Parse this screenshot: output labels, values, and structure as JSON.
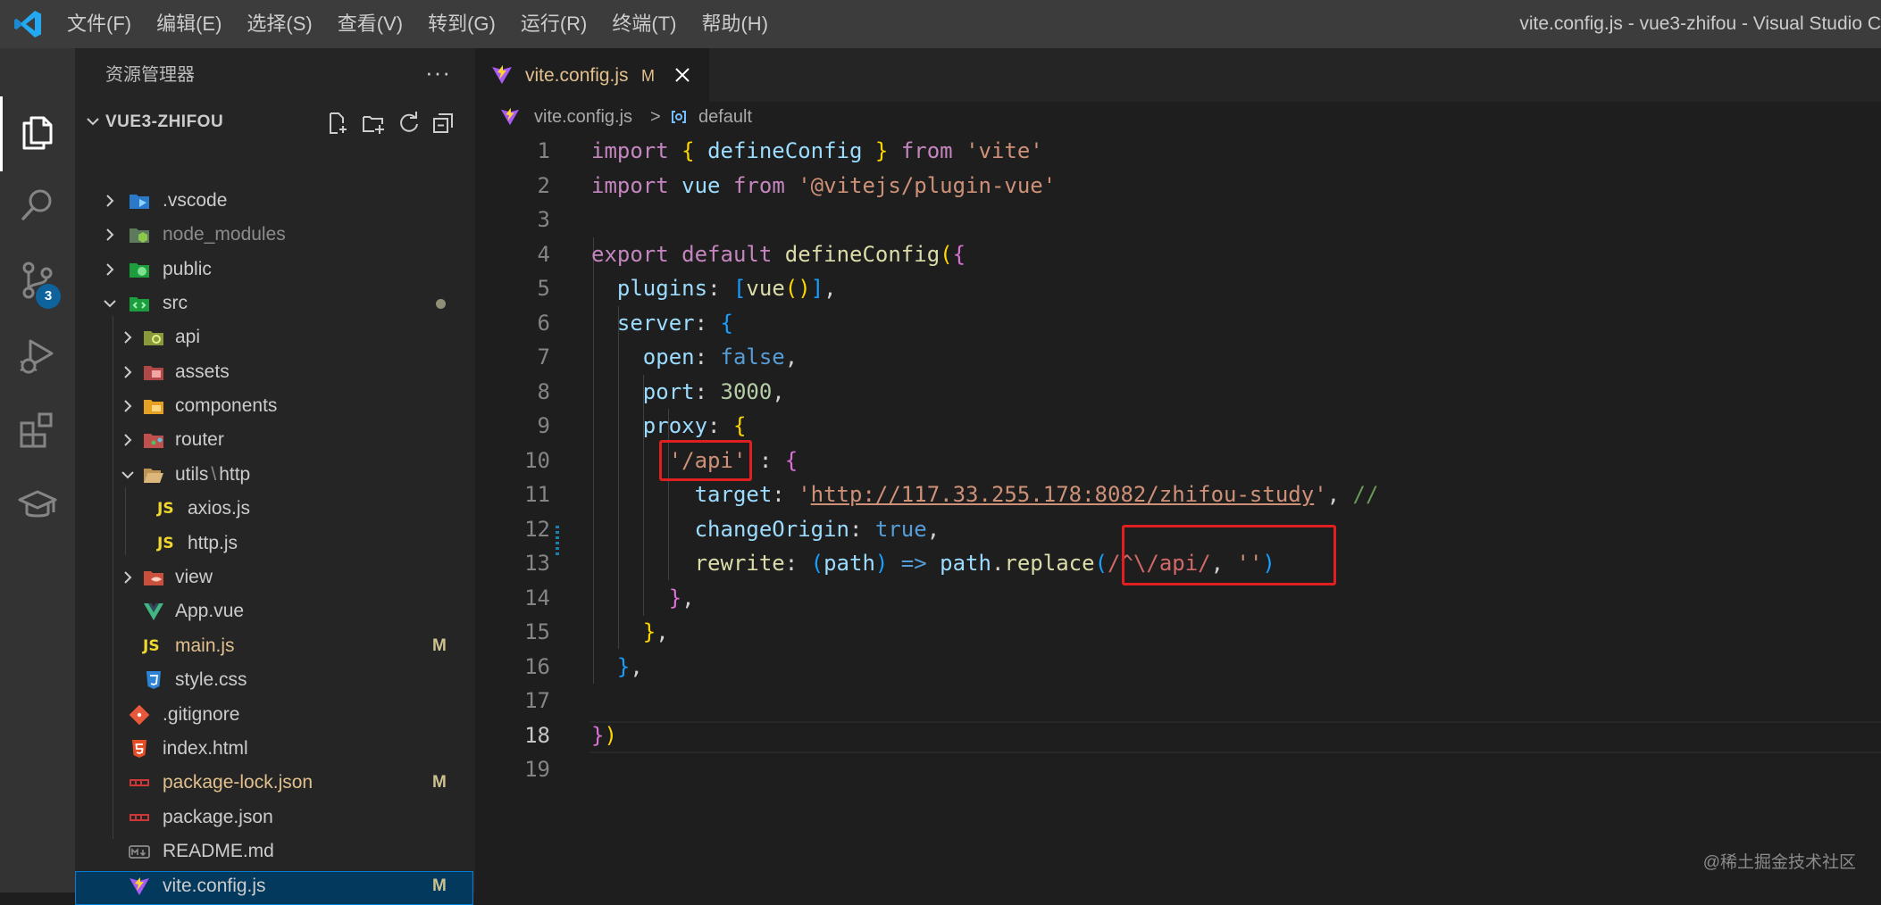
{
  "window": {
    "title": "vite.config.js - vue3-zhifou - Visual Studio C",
    "menu": [
      "文件(F)",
      "编辑(E)",
      "选择(S)",
      "查看(V)",
      "转到(G)",
      "运行(R)",
      "终端(T)",
      "帮助(H)"
    ]
  },
  "activity_bar": {
    "items": [
      "explorer-icon",
      "search-icon",
      "source-control-icon",
      "run-debug-icon",
      "extensions-icon",
      "remote-icon"
    ],
    "scm_badge": "3"
  },
  "sidebar": {
    "title": "资源管理器",
    "more": "···",
    "folder": "VUE3-ZHIFOU",
    "items": [
      {
        "name": ".vscode",
        "chevron": ">",
        "icon": "vscode-folder-icon",
        "status": ""
      },
      {
        "name": "node_modules",
        "chevron": ">",
        "icon": "node-folder-icon",
        "status": ""
      },
      {
        "name": "public",
        "chevron": ">",
        "icon": "public-folder-icon",
        "status": ""
      },
      {
        "name": "src",
        "chevron": "v",
        "icon": "src-folder-icon",
        "status": "•"
      },
      {
        "name": "api",
        "chevron": ">",
        "icon": "api-folder-icon",
        "status": ""
      },
      {
        "name": "assets",
        "chevron": ">",
        "icon": "assets-folder-icon",
        "status": ""
      },
      {
        "name": "components",
        "chevron": ">",
        "icon": "components-folder-icon",
        "status": ""
      },
      {
        "name": "router",
        "chevron": ">",
        "icon": "router-folder-icon",
        "status": ""
      },
      {
        "name": "utils",
        "name_suffix": "http",
        "chevron": "v",
        "icon": "folder-open-icon",
        "status": ""
      },
      {
        "name": "axios.js",
        "icon": "js-file-icon",
        "status": ""
      },
      {
        "name": "http.js",
        "icon": "js-file-icon",
        "status": ""
      },
      {
        "name": "view",
        "chevron": ">",
        "icon": "view-folder-icon",
        "status": ""
      },
      {
        "name": "App.vue",
        "icon": "vue-file-icon",
        "status": ""
      },
      {
        "name": "main.js",
        "icon": "js-file-icon",
        "status": "M"
      },
      {
        "name": "style.css",
        "icon": "css-file-icon",
        "status": ""
      },
      {
        "name": ".gitignore",
        "icon": "git-file-icon",
        "status": ""
      },
      {
        "name": "index.html",
        "icon": "html-file-icon",
        "status": ""
      },
      {
        "name": "package-lock.json",
        "icon": "npm-file-icon",
        "status": "M"
      },
      {
        "name": "package.json",
        "icon": "npm-file-icon",
        "status": ""
      },
      {
        "name": "README.md",
        "icon": "markdown-file-icon",
        "status": ""
      },
      {
        "name": "vite.config.js",
        "icon": "vite-file-icon",
        "status": "M"
      }
    ],
    "js_label": "JS",
    "utils_sep": "\\"
  },
  "editor": {
    "tab": {
      "label": "vite.config.js",
      "modified": "M",
      "close": "✕"
    },
    "breadcrumb": {
      "file": "vite.config.js",
      "separator": ">",
      "symbol": "default"
    },
    "active_line": 18,
    "line_numbers": [
      "1",
      "2",
      "3",
      "4",
      "5",
      "6",
      "7",
      "8",
      "9",
      "10",
      "11",
      "12",
      "13",
      "14",
      "15",
      "16",
      "17",
      "18",
      "19"
    ],
    "code": {
      "l1_import": "import",
      "l1_open": "{",
      "l1_name": "defineConfig",
      "l1_close": "}",
      "l1_from": "from",
      "l1_mod": "'vite'",
      "l2_import": "import",
      "l2_name": "vue",
      "l2_from": "from",
      "l2_mod": "'@vitejs/plugin-vue'",
      "l4_export": "export",
      "l4_default": "default",
      "l4_fn": "defineConfig",
      "l4_paren": "(",
      "l4_brace": "{",
      "l5_key": "plugins",
      "l5_colon": ": ",
      "l5_open": "[",
      "l5_fn": "vue",
      "l5_paren": "()",
      "l5_close": "]",
      "l5_comma": ",",
      "l6_key": "server",
      "l6_colon": ": ",
      "l6_brace": "{",
      "l7_key": "open",
      "l7_colon": ": ",
      "l7_val": "false",
      "l7_comma": ",",
      "l8_key": "port",
      "l8_colon": ": ",
      "l8_val": "3000",
      "l8_comma": ",",
      "l9_key": "proxy",
      "l9_colon": ": ",
      "l9_brace": "{",
      "l10_key": "'/api'",
      "l10_colon": " : ",
      "l10_brace": "{",
      "l11_key": "target",
      "l11_colon": ": ",
      "l11_q1": "'",
      "l11_url": "http://117.33.255.178:8082/zhifou-study",
      "l11_q2": "'",
      "l11_comma": ", ",
      "l11_cmt": "//",
      "l12_key": "changeOrigin",
      "l12_colon": ": ",
      "l12_val": "true",
      "l12_comma": ",",
      "l13_key": "rewrite",
      "l13_colon": ": ",
      "l13_p1": "(",
      "l13_arg": "path",
      "l13_p2": ")",
      "l13_arrow": " => ",
      "l13_obj": "path",
      "l13_dot": ".",
      "l13_fn": "replace",
      "l13_p3": "(",
      "l13_regex": "/^\\/api/",
      "l13_comma": ", ",
      "l13_str": "''",
      "l13_p4": ")",
      "l14_brace": "}",
      "l14_comma": ",",
      "l15_brace": "}",
      "l15_comma": ",",
      "l16_brace": "}",
      "l16_comma": ",",
      "l18_brace": "}",
      "l18_paren": ")"
    }
  },
  "watermark": "@稀土掘金技术社区"
}
